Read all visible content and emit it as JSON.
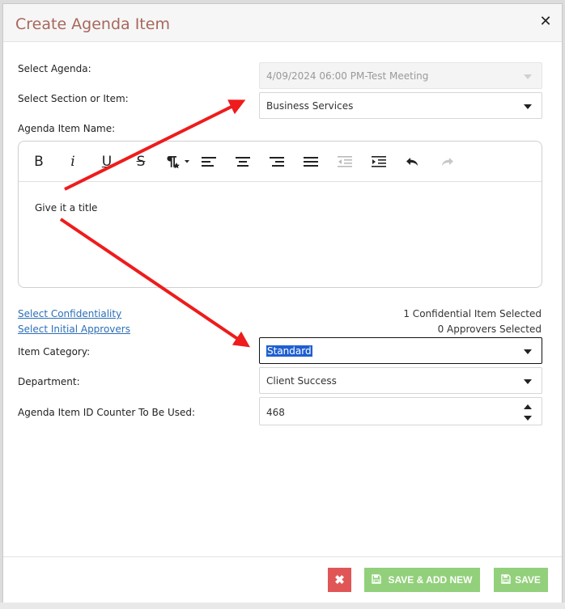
{
  "dialog": {
    "title": "Create Agenda Item",
    "close_label": "✕"
  },
  "form": {
    "agenda": {
      "label": "Select Agenda:",
      "value": "4/09/2024 06:00 PM-Test Meeting",
      "disabled": true
    },
    "section": {
      "label": "Select Section or Item:",
      "value": "Business Services"
    },
    "item_name": {
      "label": "Agenda Item Name:",
      "content": "Give it a title"
    },
    "confidentiality": {
      "link": "Select Confidentiality",
      "status": "1 Confidential Item Selected"
    },
    "approvers": {
      "link": "Select Initial Approvers",
      "status": "0 Approvers Selected"
    },
    "category": {
      "label": "Item Category:",
      "value": "Standard"
    },
    "department": {
      "label": "Department:",
      "value": "Client Success"
    },
    "id_counter": {
      "label": "Agenda Item ID Counter To Be Used:",
      "value": "468"
    }
  },
  "toolbar": {
    "buttons": [
      "bold-icon",
      "italic-icon",
      "underline-icon",
      "strikethrough-icon",
      "paragraph-format-icon",
      "align-left-icon",
      "align-center-icon",
      "align-right-icon",
      "justify-icon",
      "outdent-icon",
      "indent-icon",
      "undo-icon",
      "redo-icon"
    ],
    "bold": "B",
    "italic": "i",
    "underline": "U",
    "strike": "S"
  },
  "footer": {
    "cancel_label": "✖",
    "save_new_label": "SAVE & ADD NEW",
    "save_label": "SAVE"
  },
  "colors": {
    "title": "#a8675c",
    "link": "#2c6fb7",
    "cancel": "#e05656",
    "save": "#92d07b",
    "annotation_arrow": "#ee1c1c"
  }
}
